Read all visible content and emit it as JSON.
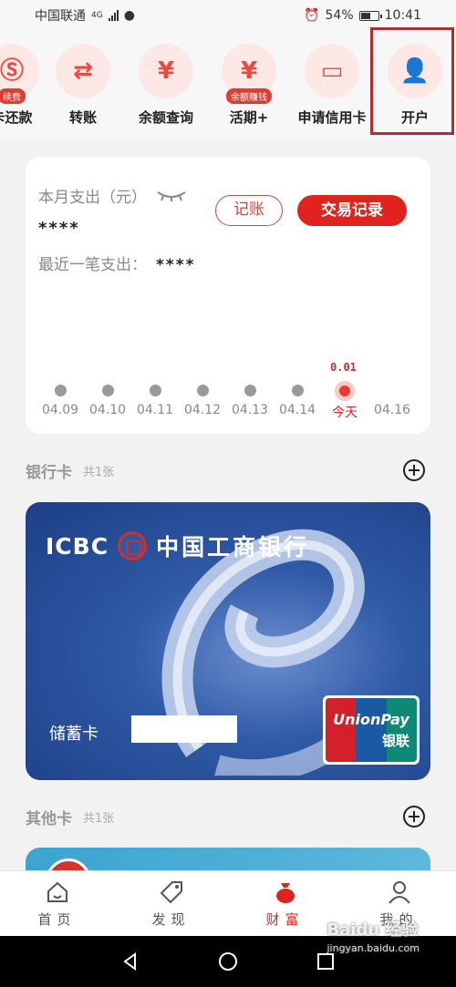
{
  "status": {
    "carrier": "中国联通",
    "network": "4G",
    "battery": "54%",
    "time": "10:41"
  },
  "quick_actions": [
    {
      "label": "卡还款",
      "badge": "续费",
      "icon": "card-repay-icon"
    },
    {
      "label": "转账",
      "badge": "",
      "icon": "transfer-icon"
    },
    {
      "label": "余额查询",
      "badge": "",
      "icon": "balance-search-icon"
    },
    {
      "label": "活期+",
      "badge": "余额赚钱",
      "icon": "demand-deposit-icon"
    },
    {
      "label": "申请信用卡",
      "badge": "",
      "icon": "credit-card-icon"
    },
    {
      "label": "开户",
      "badge": "",
      "icon": "open-account-icon"
    }
  ],
  "spend": {
    "title": "本月支出（元）",
    "amount": "****",
    "recent_label": "最近一笔支出：",
    "recent_value": "****",
    "record_btn": "记账",
    "history_btn": "交易记录",
    "today_value": "0.01",
    "days": [
      "04.09",
      "04.10",
      "04.11",
      "04.12",
      "04.13",
      "04.14",
      "今天",
      "04.16"
    ]
  },
  "bank_section": {
    "title": "银行卡",
    "count": "共1张"
  },
  "bank_card": {
    "brand": "ICBC",
    "bank_name": "中国工商银行",
    "card_type": "储蓄卡",
    "network": "UnionPay",
    "network_cn": "银联"
  },
  "other_section": {
    "title": "其他卡",
    "count": "共1张"
  },
  "bottom_nav": [
    {
      "label": "首页",
      "icon": "home-icon"
    },
    {
      "label": "发现",
      "icon": "tag-icon"
    },
    {
      "label": "财富",
      "icon": "money-bag-icon"
    },
    {
      "label": "我的",
      "icon": "user-icon"
    }
  ],
  "watermark": {
    "text": "Baidu 经验",
    "url": "jingyan.baidu.com"
  },
  "colors": {
    "accent": "#e0231f",
    "card_blue": "#2f5aa6",
    "highlight": "#b52a2a"
  }
}
